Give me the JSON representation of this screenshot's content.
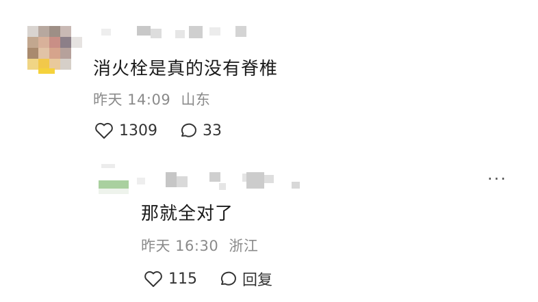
{
  "comment": {
    "text": "消火栓是真的没有脊椎",
    "time": "昨天 14:09",
    "location": "山东",
    "likes": "1309",
    "replies_count": "33",
    "like_icon": "heart-icon",
    "reply_icon": "speech-bubble-icon"
  },
  "reply": {
    "text": "那就全对了",
    "time": "昨天 16:30",
    "location": "浙江",
    "likes": "115",
    "reply_label": "回复",
    "more_label": "···",
    "like_icon": "heart-icon",
    "reply_icon": "speech-bubble-icon"
  }
}
